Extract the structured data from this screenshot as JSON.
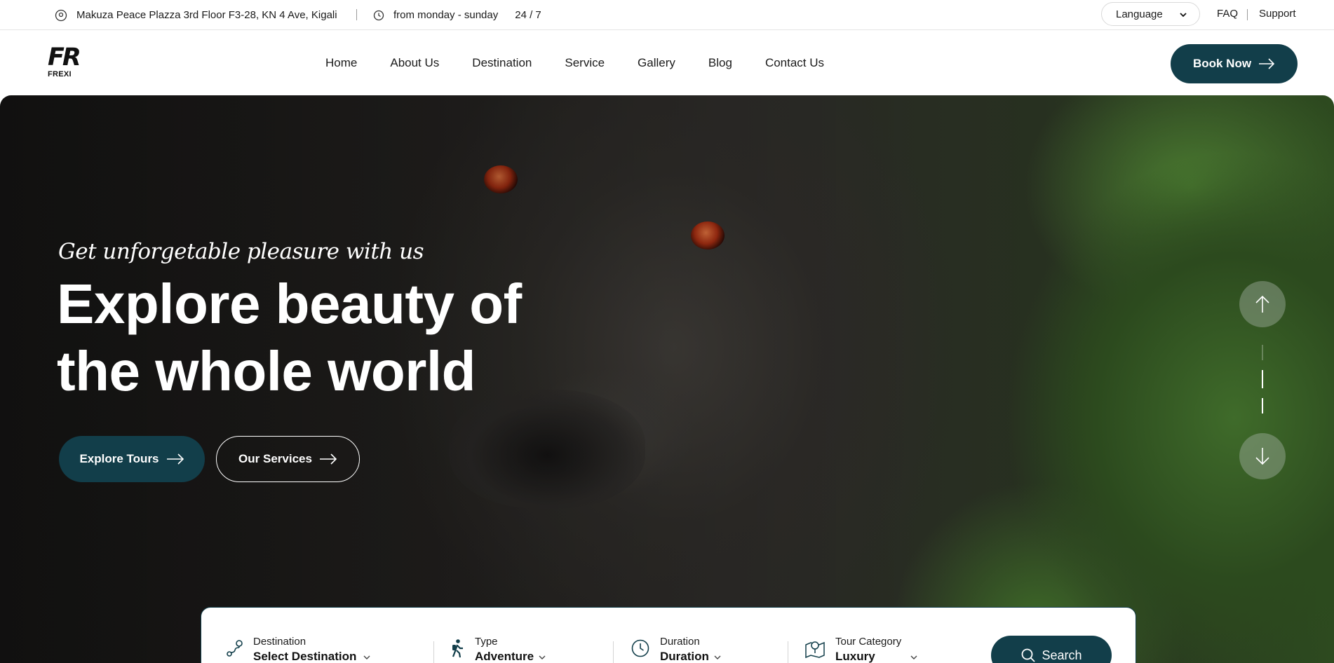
{
  "topbar": {
    "address": "Makuza Peace Plazza 3rd Floor F3-28, KN 4 Ave, Kigali",
    "hours": "from monday - sunday",
    "availability": "24 / 7",
    "language_label": "Language",
    "faq_label": "FAQ",
    "support_label": "Support"
  },
  "nav": {
    "logo_mark": "FR",
    "logo_word": "FREXI",
    "items": [
      "Home",
      "About Us",
      "Destination",
      "Service",
      "Gallery",
      "Blog",
      "Contact Us"
    ],
    "book_label": "Book Now"
  },
  "hero": {
    "tagline": "Get unforgetable pleasure with us",
    "headline_line1": "Explore beauty of",
    "headline_line2": "the whole world",
    "explore_label": "Explore Tours",
    "services_label": "Our Services"
  },
  "search": {
    "fields": [
      {
        "label": "Destination",
        "value": "Select Destination",
        "icon": "route-pin-icon"
      },
      {
        "label": "Type",
        "value": "Adventure",
        "icon": "hiker-icon"
      },
      {
        "label": "Duration",
        "value": "Duration",
        "icon": "clock-icon"
      },
      {
        "label": "Tour Category",
        "value": "Luxury",
        "icon": "map-pin-icon"
      }
    ],
    "button_label": "Search"
  },
  "colors": {
    "primary": "#123e4a",
    "text": "#1a1a1a",
    "white": "#ffffff"
  }
}
